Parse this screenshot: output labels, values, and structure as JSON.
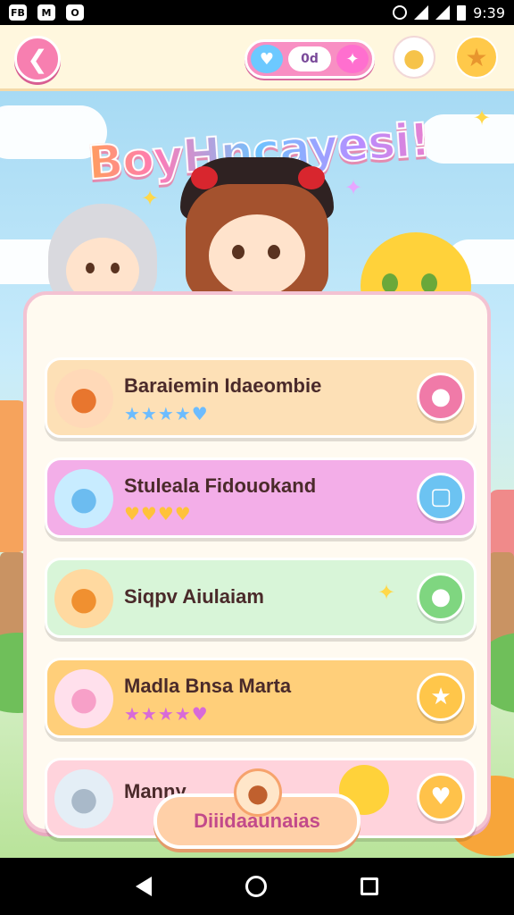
{
  "status_bar": {
    "time": "9:39",
    "app_icons": [
      "FB",
      "M",
      "O"
    ]
  },
  "topbar": {
    "back_icon": "arrow-left-icon",
    "currency_label": "0d",
    "heart_icon": "heart-icon",
    "gem_icon": "pink-gem-icon",
    "mascot_icon": "chick-mascot-icon",
    "reward_icon": "golden-bear-icon"
  },
  "title": "BoyHncayesi!",
  "items": [
    {
      "name": "Baraiemin Idaeombie",
      "rating": "★★★★♥",
      "avatar_icon": "orange-hair-girl-icon",
      "action_icon": "pink-balloon-icon",
      "color": "#fde0b6",
      "action_color": "#f07aa8"
    },
    {
      "name": "Stuleala Fidouokand",
      "rating": "♥♥♥♥",
      "avatar_icon": "blue-cat-icon",
      "action_icon": "chat-bubble-icon",
      "color": "#f3aee8",
      "action_color": "#6cc3f2"
    },
    {
      "name": "Siqpv Aiulaiam",
      "rating": "",
      "avatar_icon": "orange-lion-icon",
      "action_icon": "green-balloon-icon",
      "color": "#d8f5d8",
      "action_color": "#7fd680"
    },
    {
      "name": "Madla Bnsa Marta",
      "rating": "★★★★♥",
      "avatar_icon": "pink-cat-icon",
      "action_icon": "star-badge-icon",
      "color": "#ffcf7a",
      "action_color": "#ffc64a"
    },
    {
      "name": "Manny ",
      "rating": "",
      "avatar_icon": "grey-cat-icon",
      "action_icon": "heart-bubble-icon",
      "color": "#ffd3dc",
      "action_color": "#ffc24a"
    }
  ],
  "bottom_button": {
    "label": "Diiidaaunaias",
    "avatar_icon": "girl-avatar-icon"
  },
  "colors": {
    "accent_pink": "#f77fb0",
    "panel_border": "#f3c2d2",
    "title_gradient": [
      "#ffb02e",
      "#ff7ab6",
      "#6fc3ff",
      "#b98cff"
    ]
  }
}
